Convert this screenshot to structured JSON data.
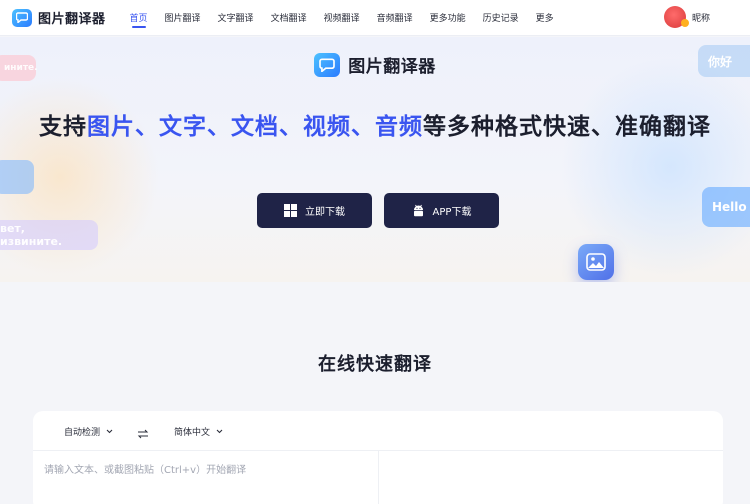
{
  "header": {
    "logo_text": "图片翻译器",
    "nav": [
      "首页",
      "图片翻译",
      "文字翻译",
      "文档翻译",
      "视频翻译",
      "音频翻译",
      "更多功能",
      "历史记录",
      "更多"
    ],
    "active_index": 0,
    "user_name": "昵称"
  },
  "hero": {
    "brand": "图片翻译器",
    "headline": {
      "pre": "支持",
      "highlight": "图片、文字、文档、视频、音频",
      "post": "等多种格式快速、准确翻译"
    },
    "download_windows": "立即下载",
    "download_app": "APP下载",
    "bubbles": {
      "left_top": "ините.",
      "left_bottom": "вет, извините.",
      "right_top": "你好",
      "right_bottom": "Hello"
    }
  },
  "translate": {
    "title": "在线快速翻译",
    "source_lang": "自动检测",
    "target_lang": "简体中文",
    "input_placeholder": "请输入文本、或截图粘贴（Ctrl+v）开始翻译"
  },
  "colors": {
    "accent": "#3a55f0",
    "button_dark": "#1f2347",
    "logo_blue": "#2b7bff"
  },
  "icons": {
    "logo": "chat-bubble-icon",
    "windows": "windows-icon",
    "android": "android-icon",
    "swap": "swap-arrows-icon",
    "chevron": "chevron-down-icon",
    "photo": "image-icon"
  }
}
